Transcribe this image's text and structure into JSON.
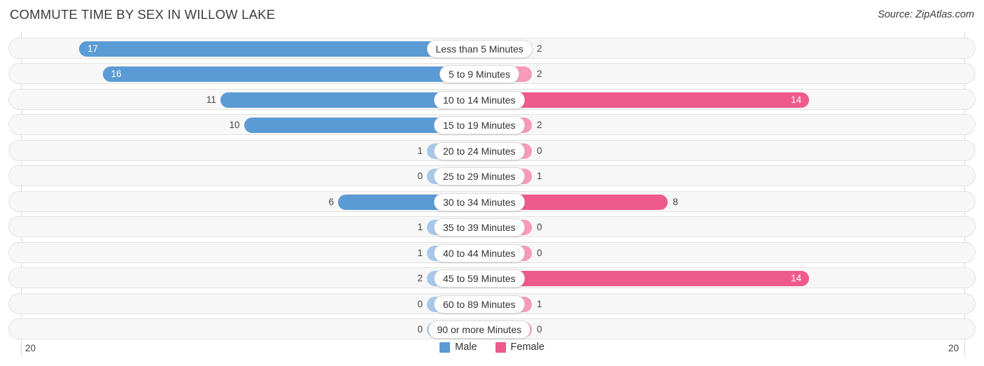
{
  "header": {
    "title": "COMMUTE TIME BY SEX IN WILLOW LAKE",
    "source": "Source: ZipAtlas.com"
  },
  "axis": {
    "left_label": "20",
    "right_label": "20",
    "max": 20
  },
  "legend": {
    "items": [
      {
        "label": "Male",
        "color": "#5b9bd5"
      },
      {
        "label": "Female",
        "color": "#ef5a8c"
      }
    ]
  },
  "colors": {
    "male_strong": "#5b9bd5",
    "male_light": "#a8c8ea",
    "female_strong": "#ef5a8c",
    "female_light": "#f79ab8",
    "track": "#f7f7f7",
    "track_border": "#e3e3e3",
    "gridline": "#d8d8d8"
  },
  "chart_data": {
    "type": "bar",
    "title": "COMMUTE TIME BY SEX IN WILLOW LAKE",
    "subtitle": "Source: ZipAtlas.com",
    "orientation": "horizontal-diverging",
    "xlabel": "",
    "ylabel": "",
    "xlim": [
      20,
      20
    ],
    "grid": true,
    "legend_position": "bottom-center",
    "categories": [
      "Less than 5 Minutes",
      "5 to 9 Minutes",
      "10 to 14 Minutes",
      "15 to 19 Minutes",
      "20 to 24 Minutes",
      "25 to 29 Minutes",
      "30 to 34 Minutes",
      "35 to 39 Minutes",
      "40 to 44 Minutes",
      "45 to 59 Minutes",
      "60 to 89 Minutes",
      "90 or more Minutes"
    ],
    "series": [
      {
        "name": "Male",
        "side": "left",
        "values": [
          17,
          16,
          11,
          10,
          1,
          0,
          6,
          1,
          1,
          2,
          0,
          0
        ]
      },
      {
        "name": "Female",
        "side": "right",
        "values": [
          2,
          2,
          14,
          2,
          0,
          1,
          8,
          0,
          0,
          14,
          1,
          0
        ]
      }
    ]
  }
}
